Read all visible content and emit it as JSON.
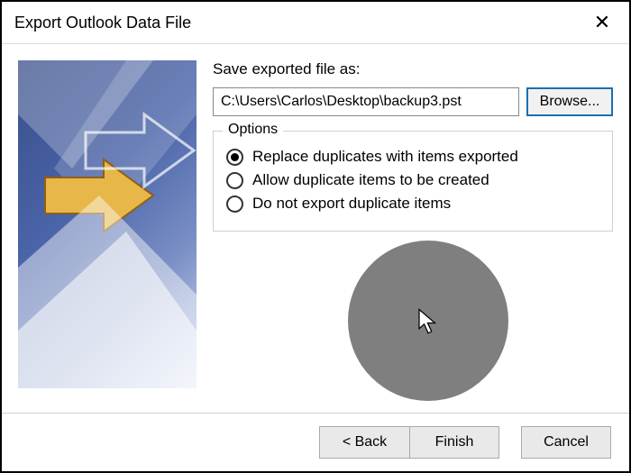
{
  "window": {
    "title": "Export Outlook Data File",
    "close_glyph": "✕"
  },
  "save_as": {
    "label": "Save exported file as:",
    "path": "C:\\Users\\Carlos\\Desktop\\backup3.pst",
    "browse_label": "Browse..."
  },
  "options": {
    "legend": "Options",
    "items": [
      {
        "label": "Replace duplicates with items exported",
        "selected": true
      },
      {
        "label": "Allow duplicate items to be created",
        "selected": false
      },
      {
        "label": "Do not export duplicate items",
        "selected": false
      }
    ]
  },
  "buttons": {
    "back": "< Back",
    "finish": "Finish",
    "cancel": "Cancel"
  }
}
